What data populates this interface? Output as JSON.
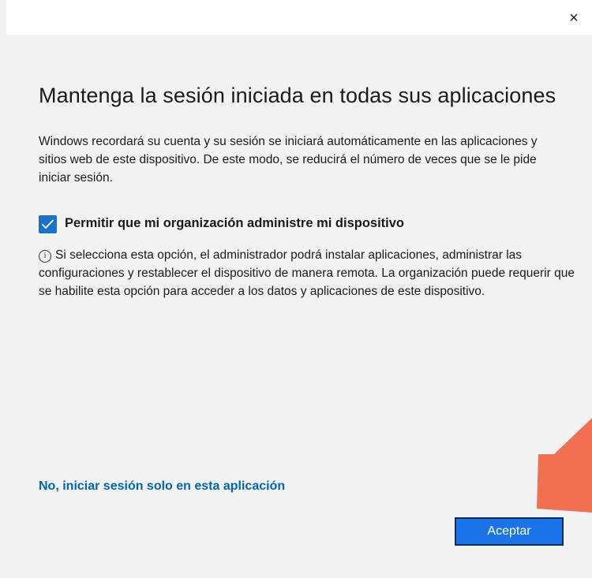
{
  "dialog": {
    "close_glyph": "×",
    "heading": "Mantenga la sesión iniciada en todas sus aplicaciones",
    "intro": "Windows recordará su cuenta y su sesión se iniciará automáticamente en las aplicaciones y sitios web de este dispositivo. De este modo, se reducirá el número de veces que se le pide iniciar sesión.",
    "checkbox": {
      "checked": true,
      "label": "Permitir que mi organización administre mi dispositivo"
    },
    "info": {
      "icon_glyph": "i",
      "text": "Si selecciona esta opción, el administrador podrá instalar aplicaciones, administrar las configuraciones y restablecer el dispositivo de manera remota. La organización puede requerir que se habilite esta opción para acceder a los datos y aplicaciones de este dispositivo."
    },
    "alt_link": "No, iniciar sesión solo en esta aplicación",
    "accept_label": "Aceptar"
  },
  "colors": {
    "accent": "#1a73e8",
    "link": "#0067b8",
    "arrow": "#f07050",
    "background": "#f2f2f2"
  }
}
